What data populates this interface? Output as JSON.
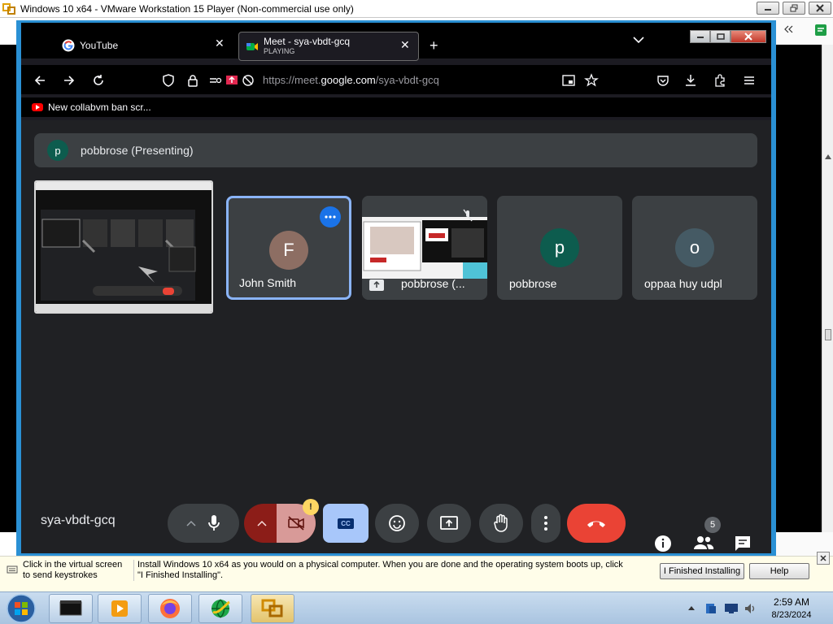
{
  "vm": {
    "title": "Windows 10 x64 - VMware Workstation 15 Player (Non-commercial use only)"
  },
  "browser": {
    "tabs": [
      {
        "label": "YouTube",
        "sublabel": ""
      },
      {
        "label": "Meet - sya-vbdt-gcq",
        "sublabel": "PLAYING"
      }
    ],
    "url_prefix": "https://meet.",
    "url_domain": "google.com",
    "url_path": "/sya-vbdt-gcq",
    "bookmark": "New collabvm ban scr..."
  },
  "meet": {
    "presenting_initial": "p",
    "presenting_text": "pobbrose (Presenting)",
    "participants": [
      {
        "name": "John Smith",
        "initial": "F",
        "color": "#8d6e63"
      },
      {
        "name": "pobbrose (...",
        "initial": "",
        "color": ""
      },
      {
        "name": "pobbrose",
        "initial": "p",
        "color": "#0d5c4e"
      },
      {
        "name": "oppaa huy udpl",
        "initial": "o",
        "color": "#455a64"
      }
    ],
    "meeting_code": "sya-vbdt-gcq",
    "participant_count": "5",
    "warning_badge": "!",
    "captions_label": "CC",
    "colors": {
      "end_call": "#ea4335",
      "captions": "#a8c7fa",
      "active_border": "#8ab4f8"
    }
  },
  "vm_message": {
    "hint": "Click in the virtual screen to send keystrokes",
    "text": "Install Windows 10 x64 as you would on a physical computer. When you are done and the operating system boots up, click \"I Finished Installing\".",
    "finished_button": "I Finished Installing",
    "help_button": "Help"
  },
  "taskbar": {
    "time": "2:59 AM",
    "date": "8/23/2024"
  }
}
